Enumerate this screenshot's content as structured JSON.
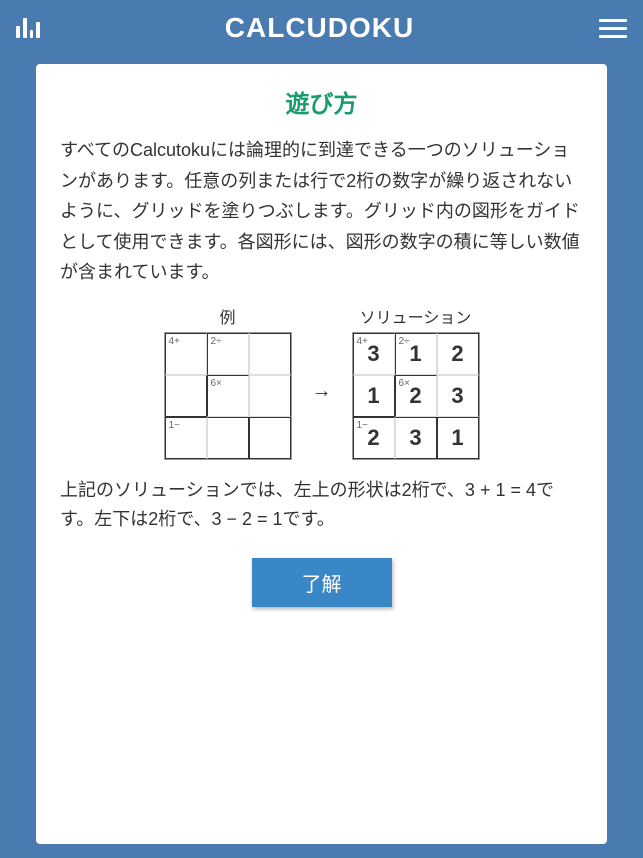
{
  "header": {
    "title": "CALCUDOKU"
  },
  "instructions": {
    "title": "遊び方",
    "body": "すべてのCalcutokuには論理的に到達できる一つのソリューションがあります。任意の列または行で2桁の数字が繰り返されないように、グリッドを塗りつぶします。グリッド内の図形をガイドとして使用できます。各図形には、図形の数字の積に等しい数値が含まれています。",
    "example_label": "例",
    "solution_label": "ソリューション",
    "arrow": "→",
    "explanation": "上記のソリューションでは、左上の形状は2桁で、3 + 1 = 4です。左下は2桁で、3 − 2 = 1です。",
    "ok_button": "了解"
  },
  "example": {
    "hints": {
      "c0": "4+",
      "c1": "2÷",
      "c4": "6×",
      "c6": "1−"
    }
  },
  "solution": {
    "hints": {
      "c0": "4+",
      "c1": "2÷",
      "c4": "6×",
      "c6": "1−"
    },
    "values": {
      "c0": "3",
      "c1": "1",
      "c2": "2",
      "c3": "1",
      "c4": "2",
      "c5": "3",
      "c6": "2",
      "c7": "3",
      "c8": "1"
    }
  }
}
